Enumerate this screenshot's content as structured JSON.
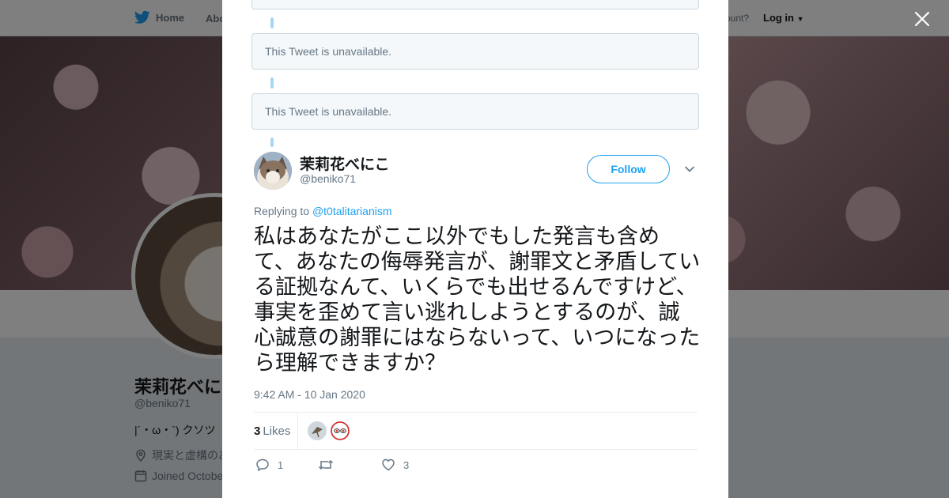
{
  "background_page": {
    "nav_home": "Home",
    "nav_about": "Abo",
    "nav_account_text": "ccount?",
    "nav_login": "Log in",
    "profile_name": "茉莉花べにこ",
    "profile_handle": "@beniko71",
    "profile_bio": "|´・ω・`) クソツ",
    "profile_location": "現実と虚構のあ",
    "profile_joined": "Joined Octobe"
  },
  "thread": {
    "unavailable_text": "This Tweet is unavailable."
  },
  "tweet": {
    "display_name": "茉莉花べにこ",
    "handle": "@beniko71",
    "follow_label": "Follow",
    "replying_prefix": "Replying to",
    "replying_to": "@t0talitarianism",
    "text": "私はあなたがここ以外でもした発言も含めて、あなたの侮辱発言が、謝罪文と矛盾している証拠なんて、いくらでも出せるんですけど、事実を歪めて言い逃れしようとするのが、誠心誠意の謝罪にはならないって、いつになったら理解できますか？",
    "timestamp": "9:42 AM - 10 Jan 2020",
    "likes_count": "3",
    "likes_label": "Likes",
    "reply_count": "1",
    "retweet_count": "",
    "like_count": "3"
  },
  "colors": {
    "accent": "#1da1f2",
    "muted": "#657786",
    "thread_line": "#a6d7f5"
  },
  "icons": [
    "twitter-bird-icon",
    "caret-down-icon",
    "close-icon",
    "reply-icon",
    "retweet-icon",
    "heart-icon",
    "location-icon",
    "calendar-icon"
  ]
}
